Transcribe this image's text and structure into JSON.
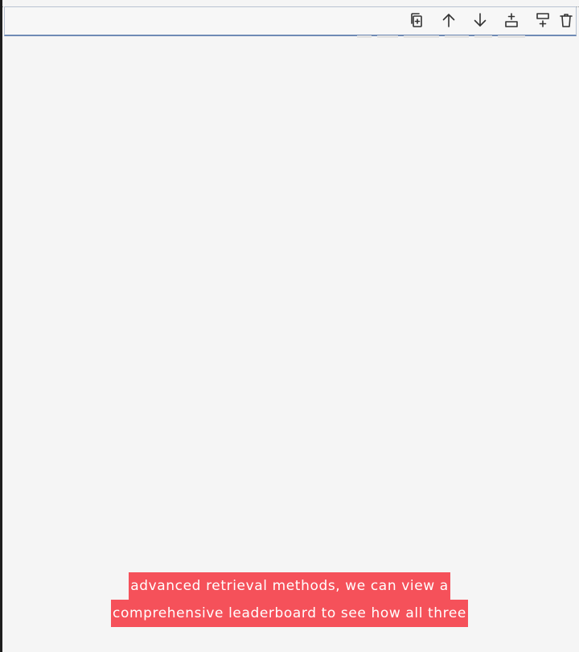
{
  "toolbar": {
    "buttons": [
      {
        "icon": "duplicate-cell-icon"
      },
      {
        "icon": "move-up-icon"
      },
      {
        "icon": "move-down-icon"
      },
      {
        "icon": "insert-above-icon"
      },
      {
        "icon": "insert-below-icon"
      },
      {
        "icon": "delete-icon"
      }
    ]
  },
  "captions": {
    "line1": "advanced retrieval methods, we can view a",
    "line2": "comprehensive leaderboard to see how all three"
  },
  "colors": {
    "background": "#f5f5f5",
    "caption_bg": "#f5515a",
    "caption_text": "#ffffff",
    "cell_border": "#6f8bb5"
  }
}
